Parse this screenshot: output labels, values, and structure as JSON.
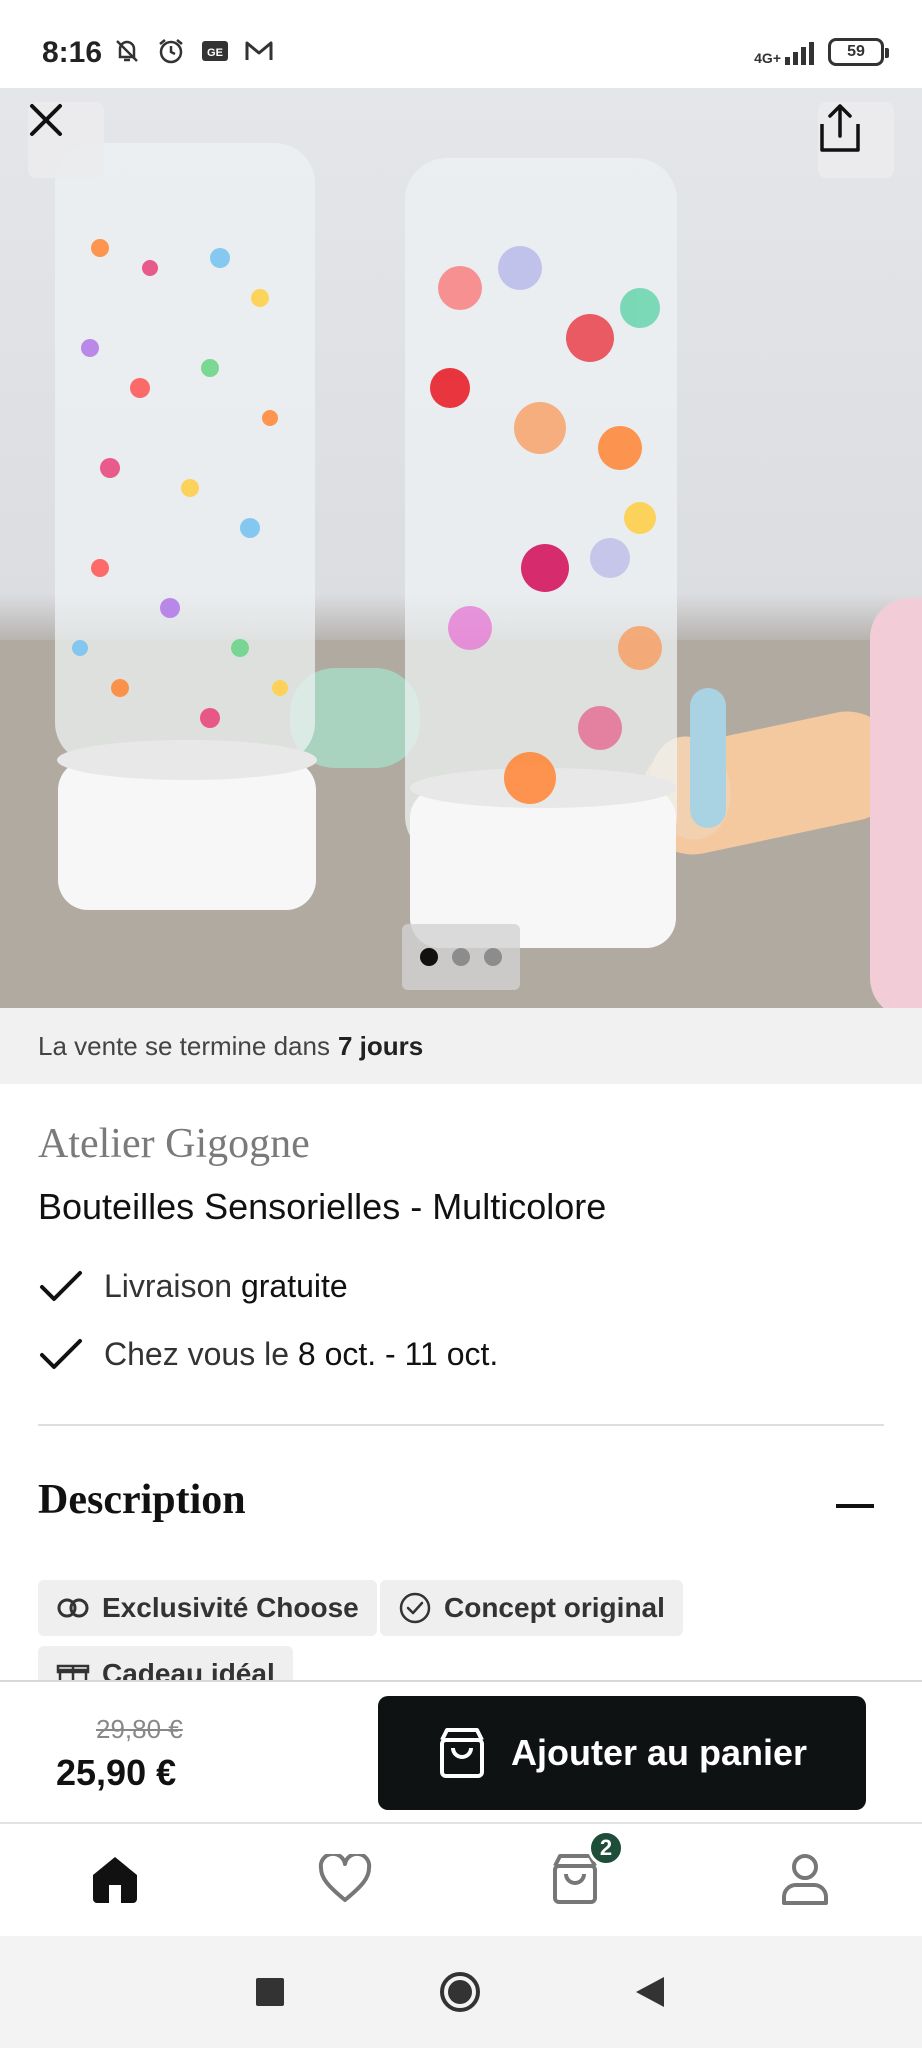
{
  "status_bar": {
    "time": "8:16",
    "network": "4G+",
    "battery": "59",
    "icons": [
      "mute-notifications-icon",
      "alarm-icon",
      "ge-app-icon",
      "gmail-icon"
    ]
  },
  "hero": {
    "image_description_icon": "product-photo",
    "carousel_pages": 3,
    "carousel_active_index": 0
  },
  "sale_banner": {
    "prefix": "La vente se termine dans",
    "duration": "7 jours"
  },
  "product": {
    "brand": "Atelier Gigogne",
    "title": "Bouteilles Sensorielles - Multicolore",
    "perks": [
      {
        "text": "Livraison",
        "strong": "gratuite"
      },
      {
        "text": "Chez vous le",
        "strong": "8 oct. - 11 oct."
      }
    ]
  },
  "description": {
    "title": "Description",
    "tags": [
      {
        "label": "Exclusivité Choose",
        "icon": "infinity-icon"
      },
      {
        "label": "Concept original",
        "icon": "check-circle-icon"
      },
      {
        "label": "Cadeau idéal",
        "icon": "gift-icon"
      }
    ]
  },
  "purchase": {
    "old_price": "29,80 €",
    "new_price": "25,90 €",
    "add_to_cart_label": "Ajouter au panier"
  },
  "bottom_nav": {
    "cart_count": "2",
    "items": [
      "home-icon",
      "heart-icon",
      "cart-icon",
      "account-icon"
    ]
  },
  "colors": {
    "primary_button": "#0f1213",
    "badge": "#1e4d3a",
    "banner_bg": "#f1f1f1"
  }
}
